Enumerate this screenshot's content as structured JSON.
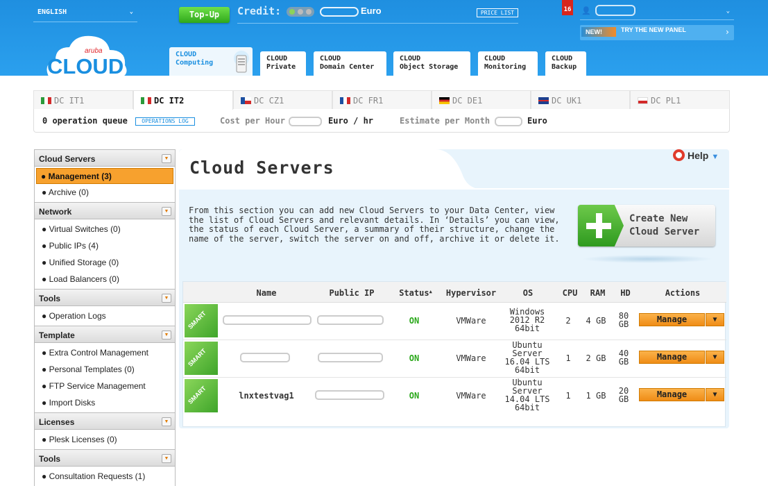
{
  "topbar": {
    "language": "ENGLISH",
    "topup_label": "Top-Up",
    "credit_label": "Credit:",
    "credit_currency": "Euro",
    "price_list": "PRICE LIST",
    "notifications": "16",
    "new_badge": "NEW!",
    "new_text": "TRY THE NEW PANEL"
  },
  "logo": {
    "small": "aruba",
    "big": "CLOUD"
  },
  "product_tabs": [
    {
      "l1": "CLOUD",
      "l2": "Computing"
    },
    {
      "l1": "CLOUD",
      "l2": "Private"
    },
    {
      "l1": "CLOUD",
      "l2": "Domain Center"
    },
    {
      "l1": "CLOUD",
      "l2": "Object Storage"
    },
    {
      "l1": "CLOUD",
      "l2": "Monitoring"
    },
    {
      "l1": "CLOUD",
      "l2": "Backup"
    }
  ],
  "dc_tabs": [
    {
      "label": "DC IT1",
      "flag": "it"
    },
    {
      "label": "DC IT2",
      "flag": "it"
    },
    {
      "label": "DC CZ1",
      "flag": "cz"
    },
    {
      "label": "DC FR1",
      "flag": "fr"
    },
    {
      "label": "DC DE1",
      "flag": "de"
    },
    {
      "label": "DC UK1",
      "flag": "uk"
    },
    {
      "label": "DC PL1",
      "flag": "pl"
    }
  ],
  "infobar": {
    "operation_queue": "0 operation queue",
    "operations_log": "OPERATIONS LOG",
    "cost_label": "Cost per Hour",
    "cost_unit": "Euro / hr",
    "estimate_label": "Estimate per Month",
    "estimate_unit": "Euro"
  },
  "sidebar": {
    "sections": [
      {
        "title": "Cloud Servers",
        "items": [
          "● Management (3)",
          "● Archive (0)"
        ]
      },
      {
        "title": "Network",
        "items": [
          "● Virtual Switches (0)",
          "● Public IPs (4)",
          "● Unified Storage (0)",
          "● Load Balancers (0)"
        ]
      },
      {
        "title": "Tools",
        "items": [
          "● Operation Logs"
        ]
      },
      {
        "title": "Template",
        "items": [
          "● Extra Control Management",
          "● Personal Templates (0)",
          "● FTP Service Management",
          "● Import Disks"
        ]
      },
      {
        "title": "Licenses",
        "items": [
          "● Plesk Licenses (0)"
        ]
      },
      {
        "title": "Tools",
        "items": [
          "● Consultation Requests (1)"
        ]
      }
    ]
  },
  "main": {
    "title": "Cloud Servers",
    "help": "Help",
    "description": "From this section you can add new Cloud Servers to your Data Center, view the list of Cloud Servers and relevant details. In ‘Details’ you can view, the status of each Cloud Server, a summary of their structure, change the name of the server, switch the server on and off, archive it or delete it.",
    "create_l1": "Create New",
    "create_l2": "Cloud Server"
  },
  "table": {
    "headers": [
      "Name",
      "Public IP",
      "Status",
      "Hypervisor",
      "OS",
      "CPU",
      "RAM",
      "HD",
      "Actions"
    ],
    "smart_label": "SMART",
    "manage_label": "Manage",
    "rows": [
      {
        "name": "",
        "status": "ON",
        "hypervisor": "VMWare",
        "os": [
          "Windows",
          "2012 R2",
          "64bit"
        ],
        "cpu": "2",
        "ram": "4 GB",
        "hd": [
          "80",
          "GB"
        ]
      },
      {
        "name": "",
        "status": "ON",
        "hypervisor": "VMWare",
        "os": [
          "Ubuntu",
          "Server",
          "16.04 LTS",
          "64bit"
        ],
        "cpu": "1",
        "ram": "2 GB",
        "hd": [
          "40",
          "GB"
        ]
      },
      {
        "name": "lnxtestvag1",
        "status": "ON",
        "hypervisor": "VMWare",
        "os": [
          "Ubuntu",
          "Server",
          "14.04 LTS",
          "64bit"
        ],
        "cpu": "1",
        "ram": "1 GB",
        "hd": [
          "20",
          "GB"
        ]
      }
    ]
  }
}
